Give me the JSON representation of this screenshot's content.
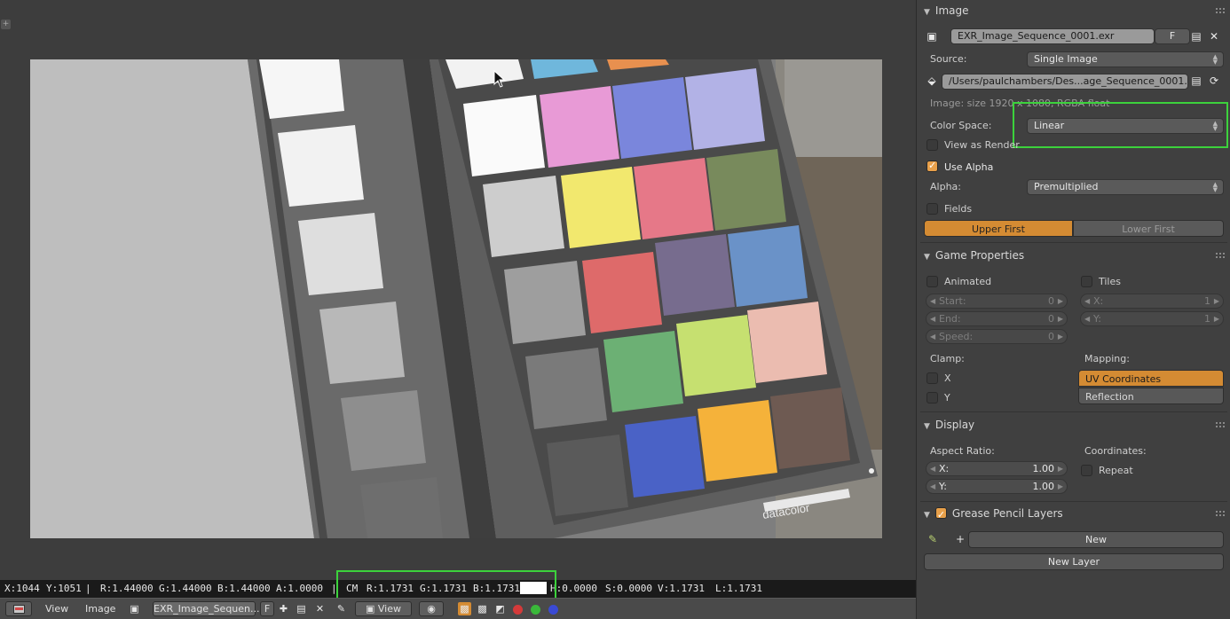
{
  "info_line": {
    "x": "X:1044",
    "y": "Y:1051",
    "sep": "|",
    "r": "R:1.44000",
    "g": "G:1.44000",
    "b": "B:1.44000",
    "a": "A:1.0000",
    "sep2": "|",
    "cm": "CM",
    "cm_r": "R:1.1731",
    "cm_g": "G:1.1731",
    "cm_b": "B:1.1731",
    "h": "H:0.0000",
    "s": "S:0.0000",
    "v": "V:1.1731",
    "l": "L:1.1731"
  },
  "header": {
    "view": "View",
    "image": "Image",
    "image_name": "EXR_Image_Sequen...",
    "fake": "F",
    "view2": "View"
  },
  "photo": {
    "brand": "datacolor"
  },
  "panel": {
    "image_section": {
      "title": "Image",
      "image_name": "EXR_Image_Sequence_0001.exr",
      "fake_user": "F",
      "source_label": "Source:",
      "source_value": "Single Image",
      "filepath": "/Users/paulchambers/Des...age_Sequence_0001.exr",
      "info": "Image: size 1920 x 1080, RGBA float",
      "color_space_label": "Color Space:",
      "color_space_value": "Linear",
      "view_as_render": "View as Render",
      "view_as_render_checked": false,
      "use_alpha": "Use Alpha",
      "use_alpha_checked": true,
      "alpha_label": "Alpha:",
      "alpha_value": "Premultiplied",
      "fields": "Fields",
      "fields_checked": false,
      "upper_first": "Upper First",
      "lower_first": "Lower First"
    },
    "game_section": {
      "title": "Game Properties",
      "animated": "Animated",
      "tiles": "Tiles",
      "start_label": "Start:",
      "start_value": "0",
      "end_label": "End:",
      "end_value": "0",
      "speed_label": "Speed:",
      "speed_value": "0",
      "tx_label": "X:",
      "tx_value": "1",
      "ty_label": "Y:",
      "ty_value": "1",
      "clamp_label": "Clamp:",
      "clamp_x": "X",
      "clamp_y": "Y",
      "mapping_label": "Mapping:",
      "mapping_uv": "UV Coordinates",
      "mapping_reflection": "Reflection"
    },
    "display_section": {
      "title": "Display",
      "aspect_label": "Aspect Ratio:",
      "ax_label": "X:",
      "ax_value": "1.00",
      "ay_label": "Y:",
      "ay_value": "1.00",
      "coordinates_label": "Coordinates:",
      "repeat": "Repeat"
    },
    "grease_section": {
      "title": "Grease Pencil Layers",
      "new_button": "New",
      "new_layer_button": "New Layer"
    }
  },
  "colors": {
    "accent_orange": "#d48b33",
    "highlight_green": "#3cd23c",
    "panel_bg": "#404040"
  }
}
